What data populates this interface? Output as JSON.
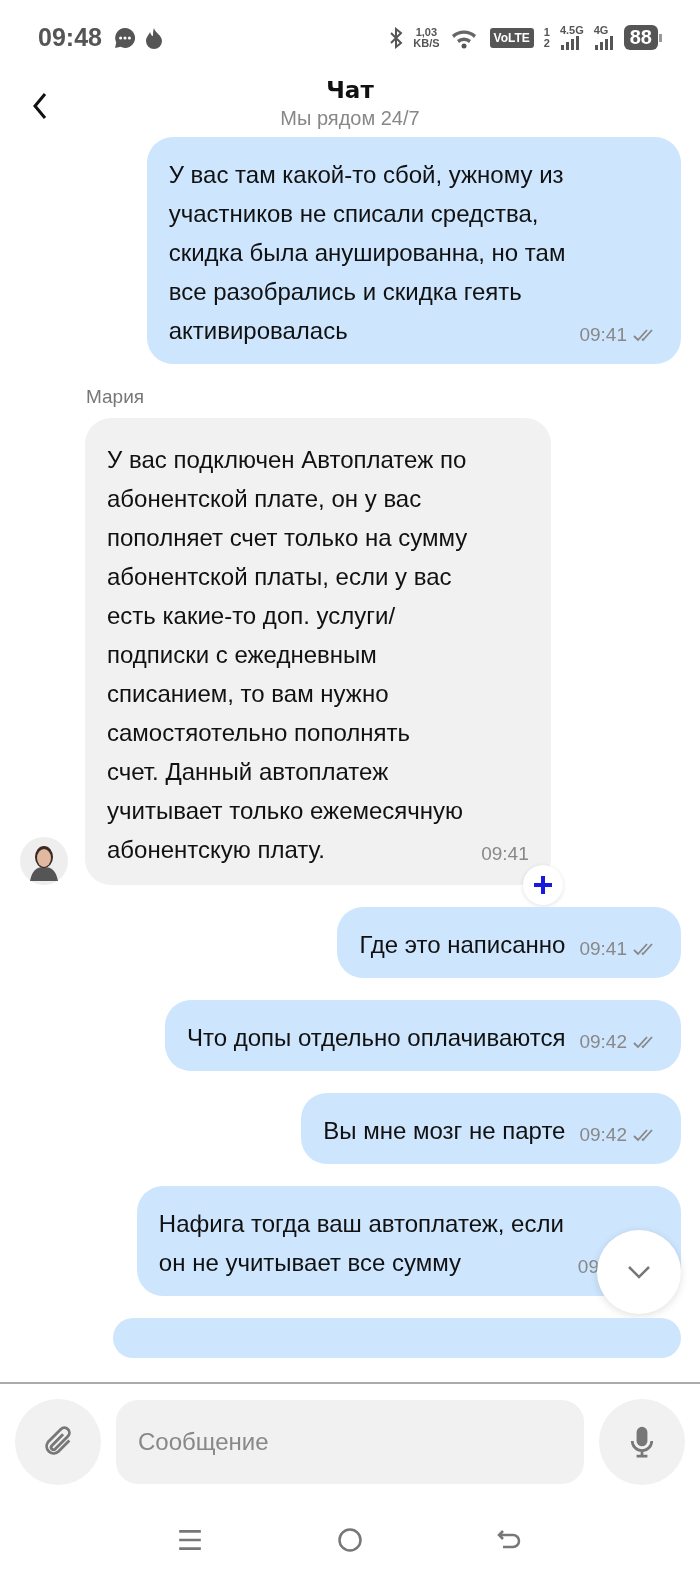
{
  "status_bar": {
    "time": "09:48",
    "speed_value": "1,03",
    "speed_unit": "KB/S",
    "volte": "VoLTE",
    "sim_1": "1",
    "sim_2": "2",
    "network_1": "4.5G",
    "network_2": "4G",
    "battery": "88"
  },
  "header": {
    "title": "Чат",
    "subtitle": "Мы рядом 24/7"
  },
  "messages": [
    {
      "kind": "outgoing",
      "text": "У вас там какой-то сбой, ужному из\nучастников не списали средства,\nскидка была анушированна, но там\nвсе разобрались и скидка геять\nактивировалась",
      "time": "09:41",
      "read": true
    },
    {
      "kind": "incoming",
      "sender": "Мария",
      "text": "У вас подключен Автоплатеж по\nабонентской плате, он у вас\nпополняет счет только на сумму\nабонентской платы, если у вас\nесть какие-то доп. услуги/\nподписки с ежедневным\nсписанием, то вам нужно\nсамостяотельно пополнять\nсчет. Данный автоплатеж\nучитывает только ежемесячную\nабонентскую плату.",
      "time": "09:41"
    },
    {
      "kind": "outgoing",
      "text": "Где это написанно",
      "time": "09:41",
      "read": true
    },
    {
      "kind": "outgoing",
      "text": "Что допы отдельно оплачиваются",
      "time": "09:42",
      "read": true
    },
    {
      "kind": "outgoing",
      "text": "Вы мне мозг не парте",
      "time": "09:42",
      "read": true
    },
    {
      "kind": "outgoing",
      "text": "Нафига тогда ваш автоплатеж, если\nон не учитывает все сумму",
      "time": "09",
      "read": false
    },
    {
      "kind": "outgoing_cut"
    }
  ],
  "composer": {
    "placeholder": "Сообщение"
  }
}
